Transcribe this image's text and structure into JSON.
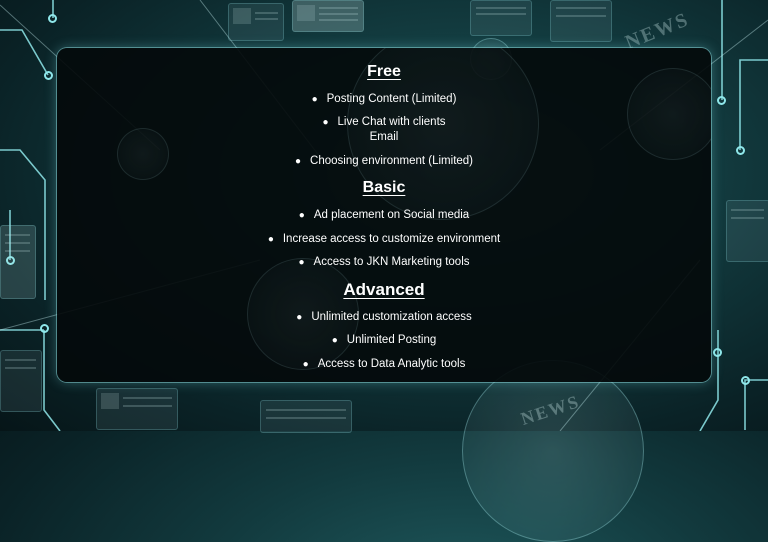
{
  "slide": {
    "sections": [
      {
        "title": "Free",
        "items": [
          {
            "text": "Posting Content (Limited)"
          },
          {
            "text": "Live Chat with clients",
            "second_line": "Email"
          },
          {
            "text": "Choosing environment (Limited)"
          }
        ]
      },
      {
        "title": "Basic",
        "items": [
          {
            "text": "Ad placement on Social media"
          },
          {
            "text": "Increase access to customize environment"
          },
          {
            "text": "Access to JKN Marketing tools"
          }
        ]
      },
      {
        "title": "Advanced",
        "items": [
          {
            "text": "Unlimited customization access"
          },
          {
            "text": "Unlimited Posting"
          },
          {
            "text": "Access to Data Analytic tools"
          }
        ]
      }
    ]
  },
  "background": {
    "news_label": "NEWS",
    "colors": {
      "base": "#0a2226",
      "glow": "#1f5a5e",
      "circuit": "#8fe7ea",
      "panel": "#040a0b"
    }
  }
}
